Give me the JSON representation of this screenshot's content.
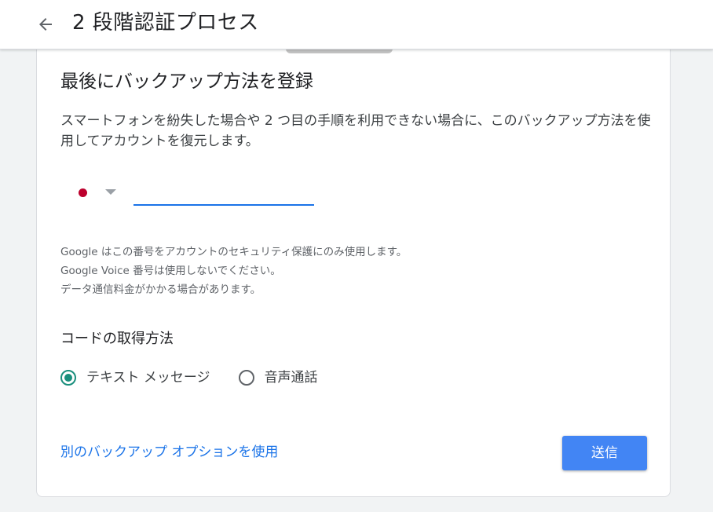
{
  "header": {
    "back_icon": "arrow-back-icon",
    "title": "2 段階認証プロセス"
  },
  "card": {
    "heading": "最後にバックアップ方法を登録",
    "description": "スマートフォンを紛失した場合や 2 つ目の手順を利用できない場合に、このバックアップ方法を使用してアカウントを復元します。",
    "phone": {
      "country_flag": "japan-flag-icon",
      "value": "",
      "placeholder": ""
    },
    "notes": [
      "Google はこの番号をアカウントのセキュリティ保護にのみ使用します。",
      "Google Voice 番号は使用しないでください。",
      "データ通信料金がかかる場合があります。"
    ],
    "method_title": "コードの取得方法",
    "methods": [
      {
        "label": "テキスト メッセージ",
        "checked": true
      },
      {
        "label": "音声通話",
        "checked": false
      }
    ],
    "alt_link": "別のバックアップ オプションを使用",
    "submit_label": "送信"
  },
  "colors": {
    "accent": "#1a73e8",
    "button": "#4285f4",
    "radio_checked": "#1a8f7d",
    "flag_red": "#bc002d"
  }
}
